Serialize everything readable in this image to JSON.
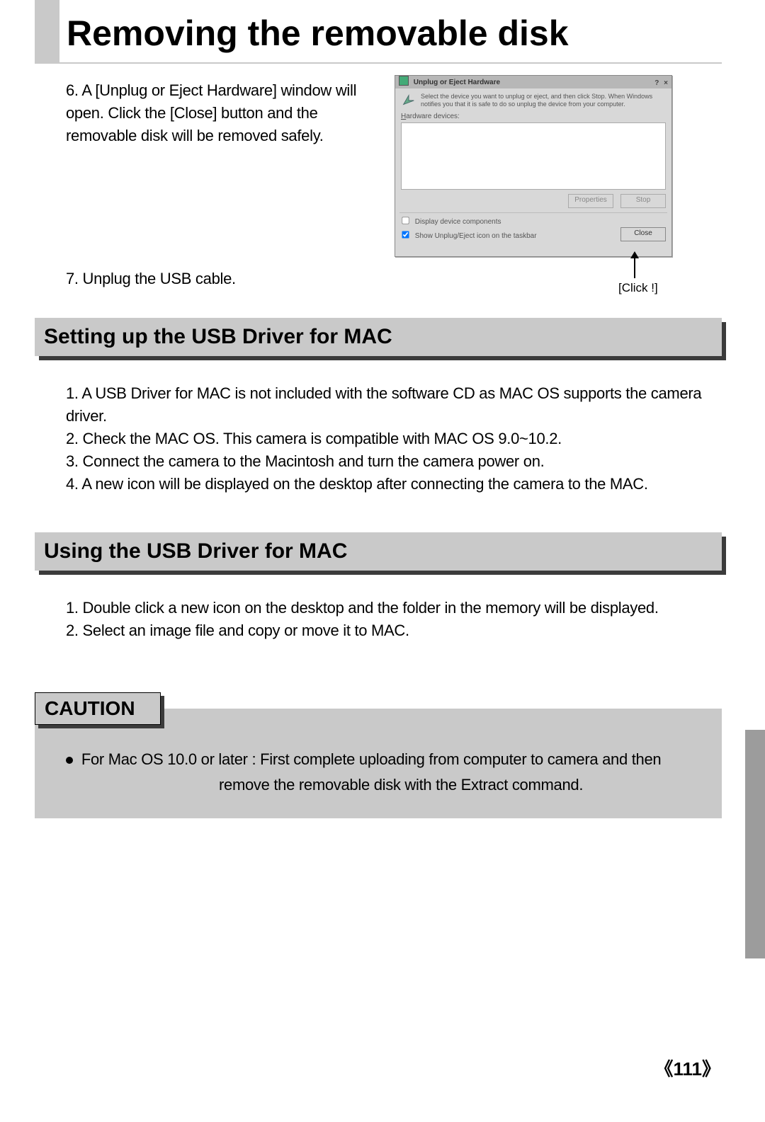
{
  "page_title": "Removing the removable disk",
  "step6": "6. A [Unplug or Eject Hardware] window will open. Click the [Close] button and the removable disk will be removed safely.",
  "step7": "7. Unplug the USB cable.",
  "click_label": "[Click !]",
  "section_setting": "Setting up the USB Driver for MAC",
  "setting_items": [
    "1. A USB Driver for MAC is not included with the software CD as MAC OS supports the camera driver.",
    "2. Check the MAC OS. This camera is compatible with MAC OS 9.0~10.2.",
    "3. Connect the camera to the Macintosh and turn the camera power on.",
    "4. A new icon will be displayed on the desktop after connecting the camera to the MAC."
  ],
  "section_using": "Using the USB Driver for MAC",
  "using_items": [
    "1. Double click a new icon on the desktop and the folder in the memory will be displayed.",
    "2. Select an image file and copy or move it to MAC."
  ],
  "caution_title": "CAUTION",
  "caution_line1": "For Mac OS 10.0 or later : First complete uploading from computer to camera and then",
  "caution_line2": "remove the removable disk with the Extract command.",
  "page_number": "《111》",
  "dialog": {
    "title": "Unplug or Eject Hardware",
    "win_buttons": "? ×",
    "desc": "Select the device you want to unplug or eject, and then click Stop. When Windows notifies you that it is safe to do so unplug the device from your computer.",
    "label_devices": "Hardware devices:",
    "btn_properties": "Properties",
    "btn_stop": "Stop",
    "chk_display": "Display device components",
    "chk_show": "Show Unplug/Eject icon on the taskbar",
    "btn_close": "Close"
  }
}
